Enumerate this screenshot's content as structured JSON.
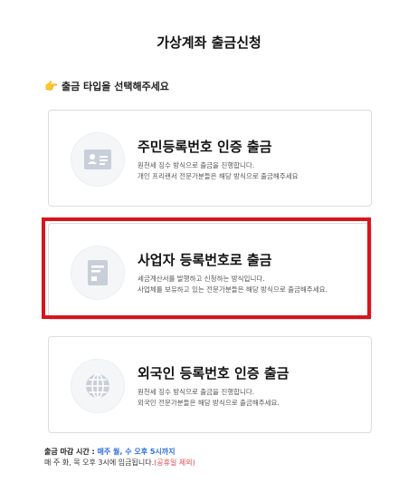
{
  "page": {
    "title": "가상계좌 출금신청"
  },
  "section": {
    "icon": "pointing-hand-icon",
    "label": "출금 타입을 선택해주세요"
  },
  "options": [
    {
      "icon": "id-card-icon",
      "title": "주민등록번호 인증 출금",
      "desc_line1": "원천세 징수 방식으로 출금을 진행합니다.",
      "desc_line2": "개인 프리랜서 전문가분들은 해당 방식으로 출금해주세요"
    },
    {
      "icon": "document-icon",
      "title": "사업자 등록번호로 출금",
      "desc_line1": "세금계산서를 발행하고 신청하는 방식입니다.",
      "desc_line2": "사업체를 보유하고 있는 전문가분들은 해당 방식으로 출금해주세요."
    },
    {
      "icon": "globe-icon",
      "title": "외국인 등록번호 인증 출금",
      "desc_line1": "원천세 징수 방식으로 출금을 진행합니다.",
      "desc_line2": "외국인 전문가분들은 해당 방식으로 출금해주세요."
    }
  ],
  "footer": {
    "deadline_label": "출금 마감 시간 : ",
    "deadline_value": "매주 월, 수 오후 5시까지",
    "deposit_text": "매 주 화, 목 오후 3시에 입금됩니다.",
    "holiday_note": "(공휴일 제외)"
  },
  "colors": {
    "highlight": "#d9141c",
    "accent": "#2f6fe0",
    "note_red": "#e0484f"
  }
}
